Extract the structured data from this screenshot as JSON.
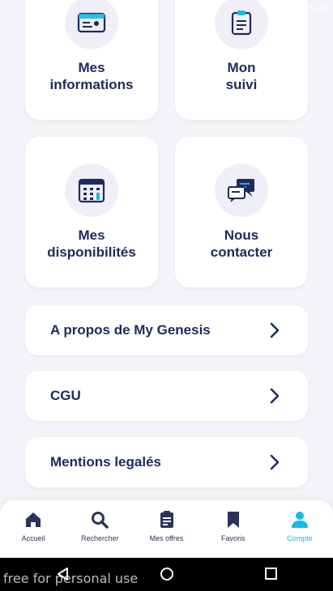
{
  "status_bar": {
    "time": "15:20"
  },
  "tiles": [
    {
      "line1": "Mes",
      "line2": "informations",
      "icon": "id-card-icon"
    },
    {
      "line1": "Mon",
      "line2": "suivi",
      "icon": "clipboard-icon"
    },
    {
      "line1": "Mes",
      "line2": "disponibilités",
      "icon": "calendar-icon"
    },
    {
      "line1": "Nous",
      "line2": "contacter",
      "icon": "chat-icon"
    }
  ],
  "rows": [
    {
      "label": "A propos de My Genesis"
    },
    {
      "label": "CGU"
    },
    {
      "label": "Mentions legalés"
    }
  ],
  "tabbar": {
    "items": [
      {
        "label": "Accueil",
        "icon": "home-icon",
        "active": false
      },
      {
        "label": "Rechercher",
        "icon": "search-icon",
        "active": false
      },
      {
        "label": "Mes offres",
        "icon": "clipboard-icon",
        "active": false
      },
      {
        "label": "Favoris",
        "icon": "bookmark-icon",
        "active": false
      },
      {
        "label": "Compte",
        "icon": "user-icon",
        "active": true
      }
    ]
  },
  "navbar": {
    "watermark": "free for personal use"
  },
  "colors": {
    "primary": "#1d2a5b",
    "accent": "#19b8e6",
    "background": "#f4f4f8"
  }
}
